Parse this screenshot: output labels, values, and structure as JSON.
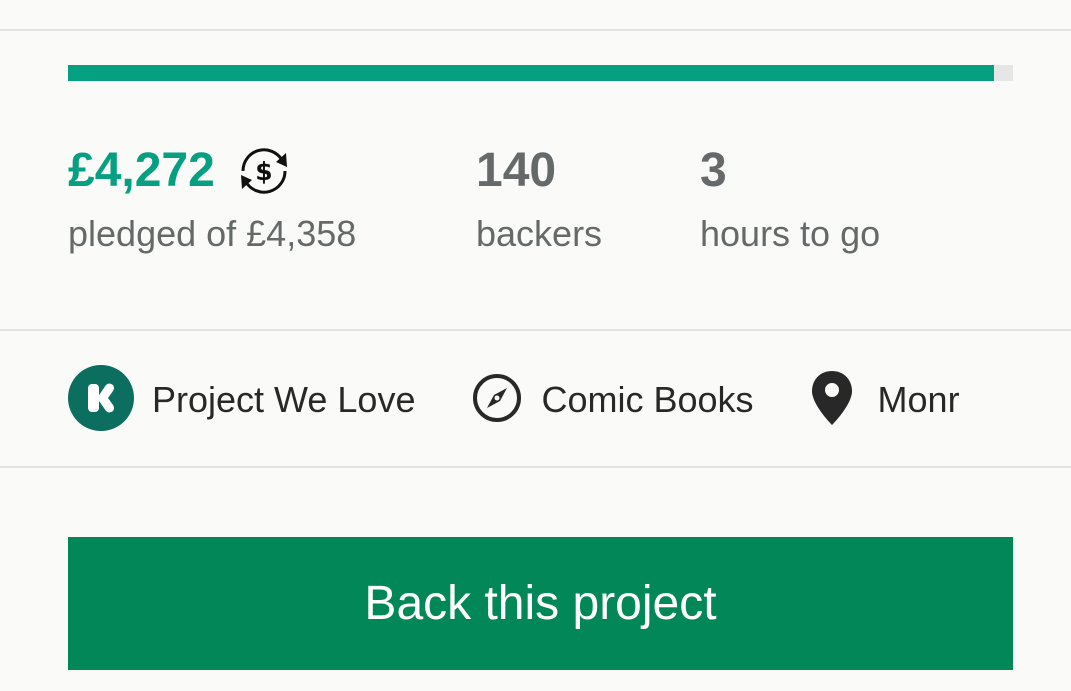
{
  "funding": {
    "progress_fraction": 0.98,
    "pledged_amount": "£4,272",
    "pledged_label": "pledged of £4,358",
    "backers_count": "140",
    "backers_label": "backers",
    "time_remaining": "3",
    "time_label": "hours to go"
  },
  "tags": [
    {
      "icon": "kickstarter-k-icon",
      "label": "Project We Love"
    },
    {
      "icon": "compass-icon",
      "label": "Comic Books"
    },
    {
      "icon": "location-pin-icon",
      "label": "Monr"
    }
  ],
  "cta": {
    "label": "Back this project"
  },
  "colors": {
    "accent": "#05a081",
    "button": "#028858",
    "text_muted": "#656969",
    "text_dark": "#282828",
    "progress_track": "#e6e6e6"
  }
}
